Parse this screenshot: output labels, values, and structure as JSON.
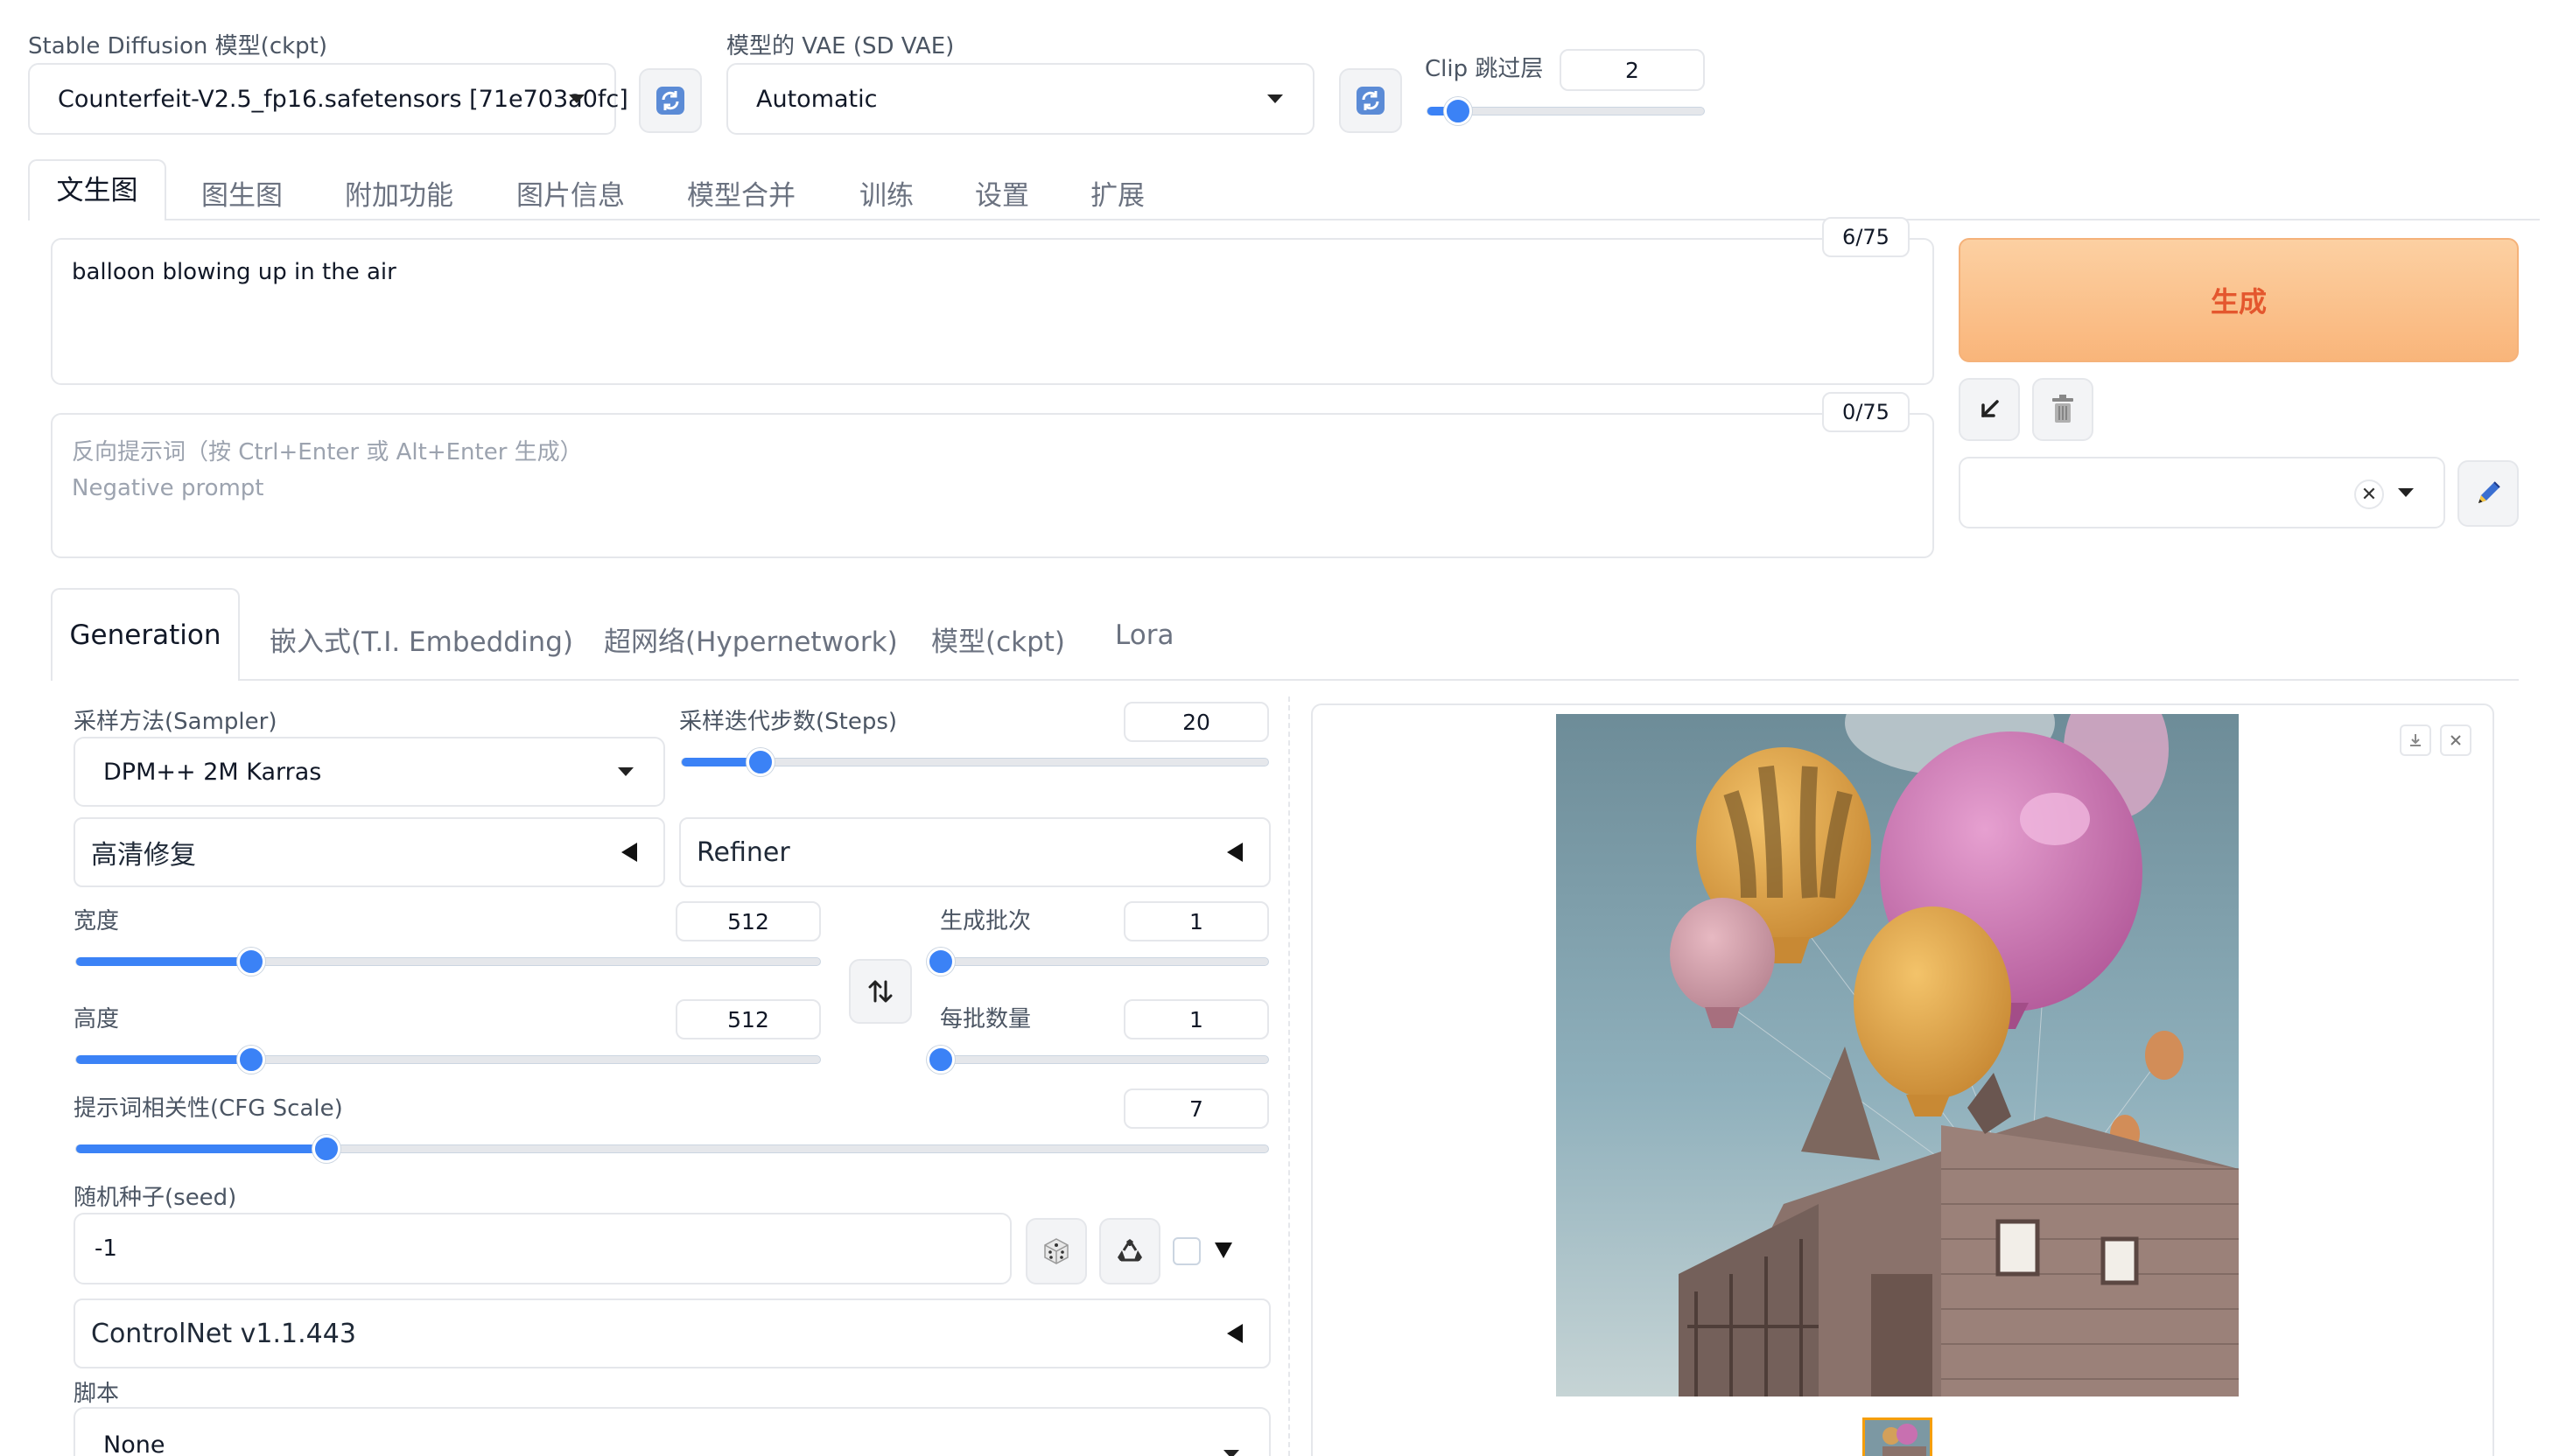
{
  "top": {
    "checkpoint_label": "Stable Diffusion 模型(ckpt)",
    "checkpoint_value": "Counterfeit-V2.5_fp16.safetensors [71e703a0fc]",
    "vae_label": "模型的 VAE (SD VAE)",
    "vae_value": "Automatic",
    "clip_label": "Clip 跳过层",
    "clip_value": "2",
    "clip_slider_fraction": 0.11
  },
  "tabs": [
    "文生图",
    "图生图",
    "附加功能",
    "图片信息",
    "模型合并",
    "训练",
    "设置",
    "扩展"
  ],
  "prompt": {
    "text": "balloon blowing up in the air",
    "token_counter": "6/75",
    "negative_placeholder_line1": "反向提示词（按 Ctrl+Enter 或 Alt+Enter 生成）",
    "negative_placeholder_line2": "Negative prompt",
    "negative_token_counter": "0/75"
  },
  "actions": {
    "generate_label": "生成",
    "generate_bg": "#fbc48e"
  },
  "subtabs": [
    "Generation",
    "嵌入式(T.I. Embedding)",
    "超网络(Hypernetwork)",
    "模型(ckpt)",
    "Lora"
  ],
  "params": {
    "sampler_label": "采样方法(Sampler)",
    "sampler_value": "DPM++ 2M Karras",
    "steps_label": "采样迭代步数(Steps)",
    "steps_value": "20",
    "steps_fraction": 0.135,
    "hires_label": "高清修复",
    "refiner_label": "Refiner",
    "width_label": "宽度",
    "width_value": "512",
    "width_fraction": 0.235,
    "height_label": "高度",
    "height_value": "512",
    "height_fraction": 0.235,
    "batch_count_label": "生成批次",
    "batch_count_value": "1",
    "batch_count_fraction": 0.0,
    "batch_size_label": "每批数量",
    "batch_size_value": "1",
    "batch_size_fraction": 0.0,
    "cfg_label": "提示词相关性(CFG Scale)",
    "cfg_value": "7",
    "cfg_fraction": 0.21,
    "seed_label": "随机种子(seed)",
    "seed_value": "-1",
    "controlnet_label": "ControlNet v1.1.443",
    "script_label": "脚本",
    "script_value": "None"
  },
  "colors": {
    "accent": "#3b82f6",
    "generate_text": "#e4572e"
  },
  "icons": [
    "refresh-icon",
    "arrow-down-left-icon",
    "trash-icon",
    "pencil-icon",
    "swap-icon",
    "dice-icon",
    "recycle-icon",
    "download-icon",
    "close-icon"
  ]
}
